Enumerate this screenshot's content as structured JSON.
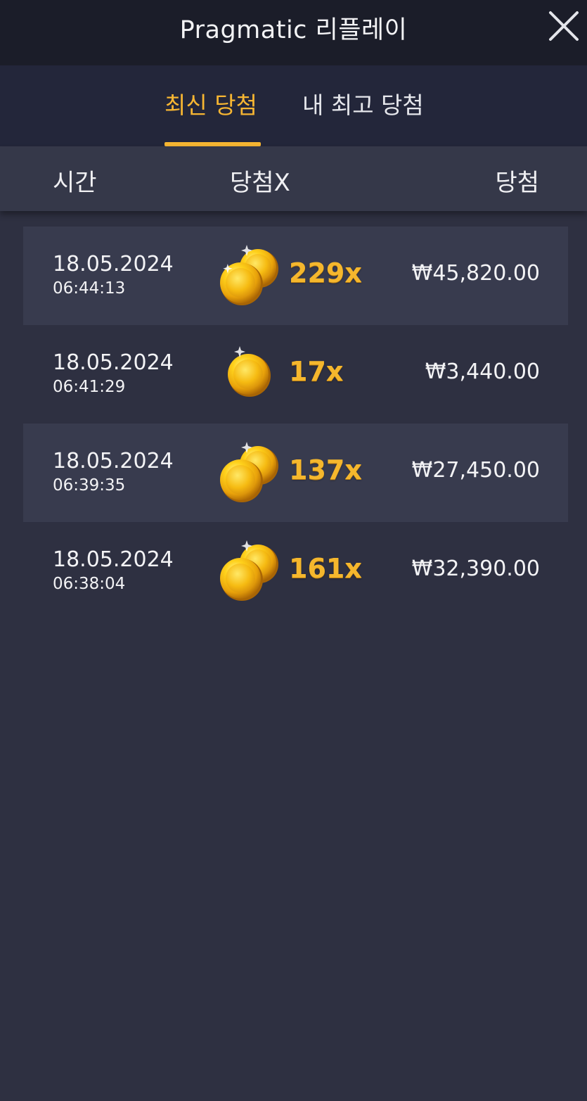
{
  "header": {
    "title": "Pragmatic 리플레이"
  },
  "tabs": {
    "latest": "최신 당첨",
    "best": "내 최고 당첨"
  },
  "columns": {
    "time": "시간",
    "multiplier": "당첨X",
    "win": "당첨"
  },
  "colors": {
    "accent": "#f7b632",
    "background": "#2e3041",
    "header": "#1b1d29"
  },
  "rows": [
    {
      "date": "18.05.2024",
      "time": "06:44:13",
      "multiplier": "229x",
      "win": "₩45,820.00",
      "coin_icon": "double-coin-icon"
    },
    {
      "date": "18.05.2024",
      "time": "06:41:29",
      "multiplier": "17x",
      "win": "₩3,440.00",
      "coin_icon": "single-coin-icon"
    },
    {
      "date": "18.05.2024",
      "time": "06:39:35",
      "multiplier": "137x",
      "win": "₩27,450.00",
      "coin_icon": "double-coin-icon"
    },
    {
      "date": "18.05.2024",
      "time": "06:38:04",
      "multiplier": "161x",
      "win": "₩32,390.00",
      "coin_icon": "double-coin-icon"
    }
  ]
}
